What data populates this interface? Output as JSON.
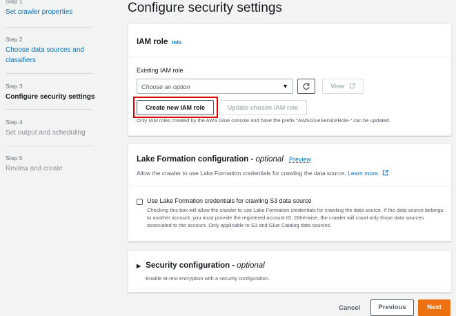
{
  "sidebar": {
    "steps": [
      {
        "num": "Step 1",
        "label": "Set crawler properties"
      },
      {
        "num": "Step 2",
        "label": "Choose data sources and classifiers"
      },
      {
        "num": "Step 3",
        "label": "Configure security settings"
      },
      {
        "num": "Step 4",
        "label": "Set output and scheduling"
      },
      {
        "num": "Step 5",
        "label": "Review and create"
      }
    ]
  },
  "page": {
    "title": "Configure security settings"
  },
  "iam": {
    "heading": "IAM role",
    "info": "Info",
    "existing_label": "Existing IAM role",
    "select_placeholder": "Choose an option",
    "refresh_icon": "refresh-icon",
    "view_label": "View",
    "view_icon": "external-link-icon",
    "create_label": "Create new IAM role",
    "update_label": "Update chosen IAM role",
    "note": "Only IAM roles created by the AWS Glue console and have the prefix \"AWSGlueServiceRole-\" can be updated."
  },
  "lake": {
    "heading": "Lake Formation configuration - ",
    "heading_optional": "optional",
    "preview": "Preview",
    "desc": "Allow the crawler to use Lake Formation credentials for crawling the data source.",
    "learn_more": "Learn more.",
    "checkbox_label": "Use Lake Formation credentials for crawling S3 data source",
    "checkbox_desc": "Checking this box will allow the crawler to use Lake Formation credentials for crawling the data source. If the data source belongs to another account, you must provide the registered account ID. Otherwise, the crawler will crawl only those data sources associated to the account. Only applicable to S3 and Glue Catalog data sources."
  },
  "security": {
    "heading": "Security configuration - ",
    "heading_optional": "optional",
    "desc": "Enable at-rest encryption with a security configuration."
  },
  "footer": {
    "cancel": "Cancel",
    "previous": "Previous",
    "next": "Next"
  },
  "colors": {
    "accent": "#ec7211",
    "link": "#0073bb",
    "highlight": "#dd0000"
  }
}
